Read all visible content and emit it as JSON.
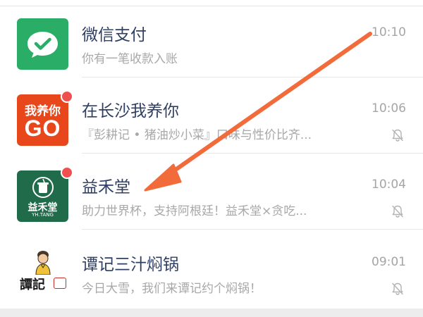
{
  "chats": [
    {
      "name": "微信支付",
      "preview": "你有一笔收款入账",
      "time": "10:10",
      "unread": false,
      "muted": false,
      "avatar_icon": "wechat-pay-icon"
    },
    {
      "name": "在长沙我养你",
      "preview": "『彭耕记 • 猪油炒小菜』口味与性价比齐...",
      "time": "10:06",
      "unread": true,
      "muted": true,
      "avatar_icon": "changsha-go-logo",
      "avatar_text_top": "我养你",
      "avatar_text_main": "GO"
    },
    {
      "name": "益禾堂",
      "preview": "助力世界杯，支持阿根廷！益禾堂×贪吃...",
      "time": "10:04",
      "unread": true,
      "muted": true,
      "avatar_icon": "yihetang-logo",
      "avatar_text_main": "益禾堂",
      "avatar_text_sub": "YH.TANG"
    },
    {
      "name": "谭记三汁焖锅",
      "preview": "今日大雪，我们来谭记约个焖锅！",
      "time": "09:01",
      "unread": false,
      "muted": true,
      "avatar_icon": "tanji-logo",
      "avatar_text_main": "譚記"
    }
  ],
  "annotation": {
    "type": "arrow",
    "color": "#f26b3a",
    "points_to": "益禾堂"
  },
  "colors": {
    "name_text": "#2f3f63",
    "preview_text": "#a8a8a8",
    "time_text": "#a5a5a5",
    "unread_badge": "#ef4f4f",
    "wechat_pay_green": "#2aae67",
    "changsha_orange": "#e8471c",
    "yihetang_green": "#1f6b4a"
  }
}
